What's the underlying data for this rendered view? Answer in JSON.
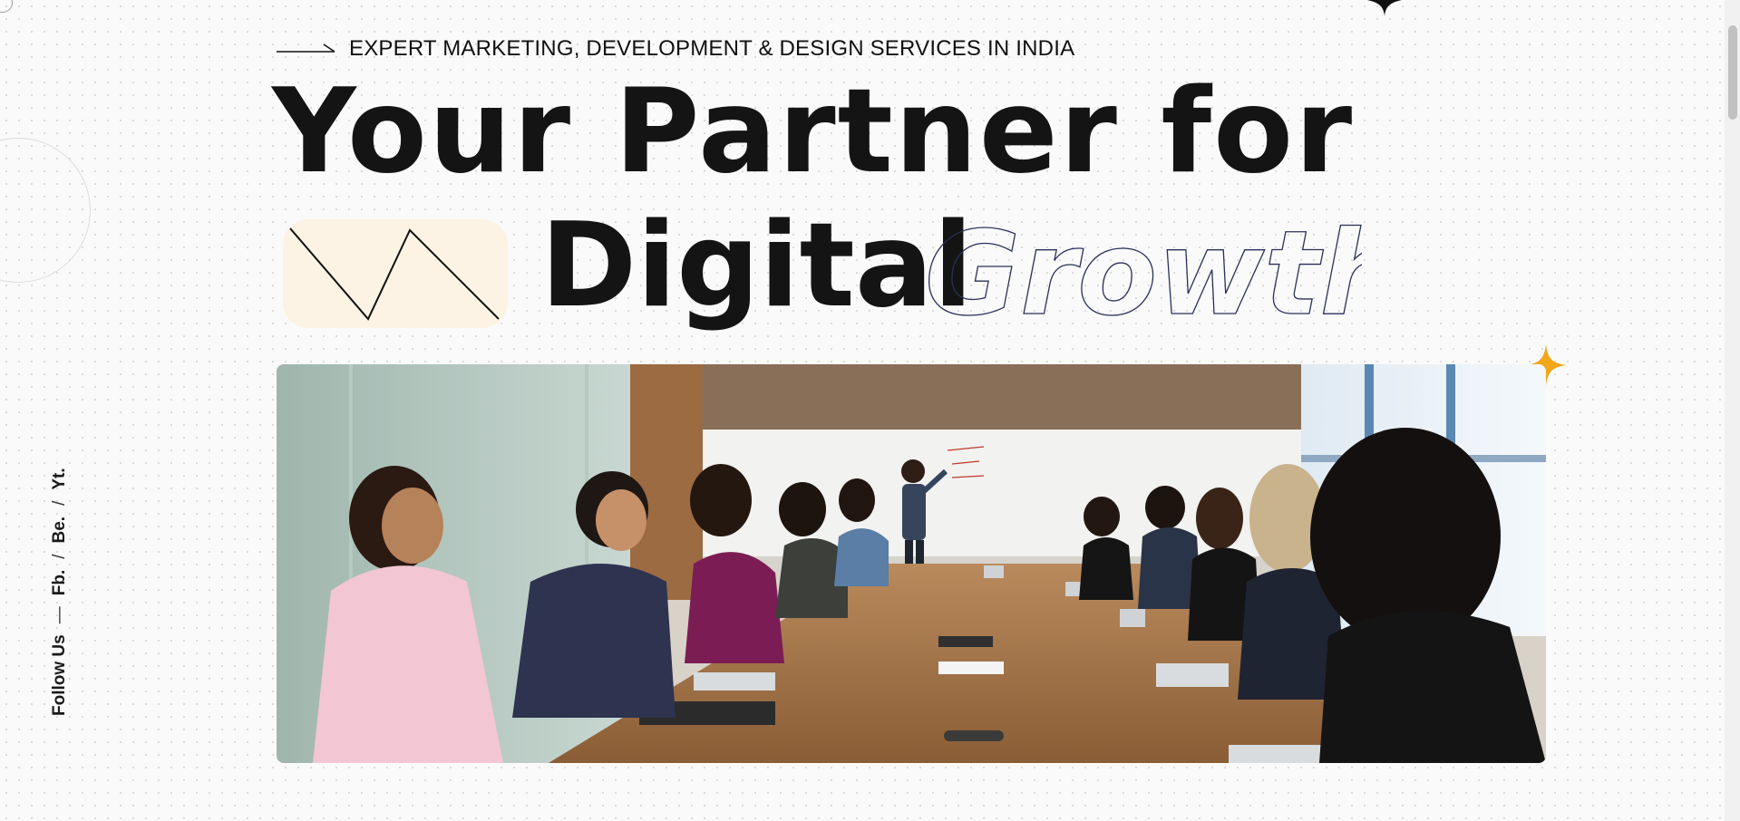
{
  "hero": {
    "tagline": "EXPERT MARKETING, DEVELOPMENT & DESIGN SERVICES IN INDIA",
    "headline_line1": "Your Partner for",
    "headline_word1": "Digital",
    "headline_word2": "Growth",
    "image_alt": "Team meeting in a conference room with presenter at whiteboard"
  },
  "social": {
    "label": "Follow Us",
    "dash": "—",
    "separator": "/",
    "links": [
      "Fb.",
      "Be.",
      "Yt."
    ]
  },
  "colors": {
    "accent_star": "#f2a61a",
    "highlight_box": "#fdf3e4",
    "text": "#141414",
    "outline_text": "#2b2f5a"
  },
  "icons": {
    "tagline_arrow": "long-arrow-right-icon",
    "accent_star": "four-point-star-icon",
    "zigzag": "zigzag-line-icon"
  }
}
